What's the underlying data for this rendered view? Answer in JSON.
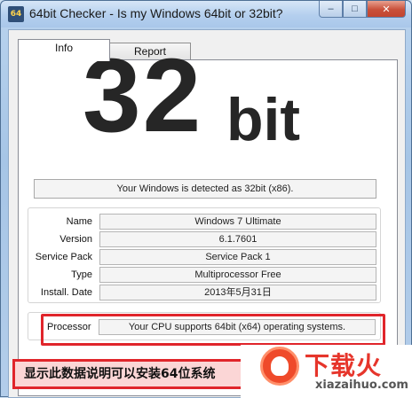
{
  "window": {
    "title": "64bit Checker - Is my Windows 64bit or 32bit?",
    "icon_text": "64",
    "controls": {
      "minimize": "–",
      "maximize": "□",
      "close": "✕"
    }
  },
  "tabs": [
    {
      "label": "Info",
      "active": true
    },
    {
      "label": "Report",
      "active": false
    }
  ],
  "result": {
    "number": "32",
    "unit": "bit",
    "detected_text": "Your Windows is detected as 32bit (x86)."
  },
  "details": [
    {
      "label": "Name",
      "value": "Windows 7 Ultimate"
    },
    {
      "label": "Version",
      "value": "6.1.7601"
    },
    {
      "label": "Service Pack",
      "value": "Service Pack 1"
    },
    {
      "label": "Type",
      "value": "Multiprocessor Free"
    },
    {
      "label": "Install. Date",
      "value": "2013年5月31日"
    }
  ],
  "processor": {
    "label": "Processor",
    "value": "Your CPU supports 64bit (x64) operating systems."
  },
  "annotation": {
    "text": "显示此数据说明可以安装64位系统",
    "highlight_color": "#e0252b"
  },
  "watermark": {
    "title": "下载火",
    "subtitle": "xiazaihuo.com"
  }
}
